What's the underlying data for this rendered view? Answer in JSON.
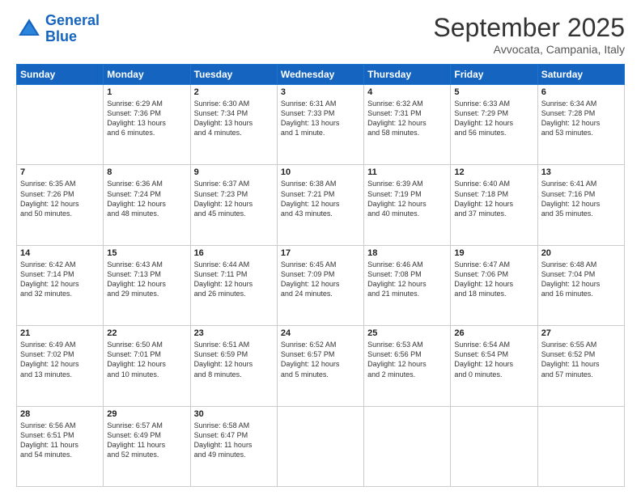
{
  "logo": {
    "line1": "General",
    "line2": "Blue"
  },
  "title": "September 2025",
  "location": "Avvocata, Campania, Italy",
  "weekdays": [
    "Sunday",
    "Monday",
    "Tuesday",
    "Wednesday",
    "Thursday",
    "Friday",
    "Saturday"
  ],
  "weeks": [
    [
      {
        "day": "",
        "info": ""
      },
      {
        "day": "1",
        "info": "Sunrise: 6:29 AM\nSunset: 7:36 PM\nDaylight: 13 hours\nand 6 minutes."
      },
      {
        "day": "2",
        "info": "Sunrise: 6:30 AM\nSunset: 7:34 PM\nDaylight: 13 hours\nand 4 minutes."
      },
      {
        "day": "3",
        "info": "Sunrise: 6:31 AM\nSunset: 7:33 PM\nDaylight: 13 hours\nand 1 minute."
      },
      {
        "day": "4",
        "info": "Sunrise: 6:32 AM\nSunset: 7:31 PM\nDaylight: 12 hours\nand 58 minutes."
      },
      {
        "day": "5",
        "info": "Sunrise: 6:33 AM\nSunset: 7:29 PM\nDaylight: 12 hours\nand 56 minutes."
      },
      {
        "day": "6",
        "info": "Sunrise: 6:34 AM\nSunset: 7:28 PM\nDaylight: 12 hours\nand 53 minutes."
      }
    ],
    [
      {
        "day": "7",
        "info": "Sunrise: 6:35 AM\nSunset: 7:26 PM\nDaylight: 12 hours\nand 50 minutes."
      },
      {
        "day": "8",
        "info": "Sunrise: 6:36 AM\nSunset: 7:24 PM\nDaylight: 12 hours\nand 48 minutes."
      },
      {
        "day": "9",
        "info": "Sunrise: 6:37 AM\nSunset: 7:23 PM\nDaylight: 12 hours\nand 45 minutes."
      },
      {
        "day": "10",
        "info": "Sunrise: 6:38 AM\nSunset: 7:21 PM\nDaylight: 12 hours\nand 43 minutes."
      },
      {
        "day": "11",
        "info": "Sunrise: 6:39 AM\nSunset: 7:19 PM\nDaylight: 12 hours\nand 40 minutes."
      },
      {
        "day": "12",
        "info": "Sunrise: 6:40 AM\nSunset: 7:18 PM\nDaylight: 12 hours\nand 37 minutes."
      },
      {
        "day": "13",
        "info": "Sunrise: 6:41 AM\nSunset: 7:16 PM\nDaylight: 12 hours\nand 35 minutes."
      }
    ],
    [
      {
        "day": "14",
        "info": "Sunrise: 6:42 AM\nSunset: 7:14 PM\nDaylight: 12 hours\nand 32 minutes."
      },
      {
        "day": "15",
        "info": "Sunrise: 6:43 AM\nSunset: 7:13 PM\nDaylight: 12 hours\nand 29 minutes."
      },
      {
        "day": "16",
        "info": "Sunrise: 6:44 AM\nSunset: 7:11 PM\nDaylight: 12 hours\nand 26 minutes."
      },
      {
        "day": "17",
        "info": "Sunrise: 6:45 AM\nSunset: 7:09 PM\nDaylight: 12 hours\nand 24 minutes."
      },
      {
        "day": "18",
        "info": "Sunrise: 6:46 AM\nSunset: 7:08 PM\nDaylight: 12 hours\nand 21 minutes."
      },
      {
        "day": "19",
        "info": "Sunrise: 6:47 AM\nSunset: 7:06 PM\nDaylight: 12 hours\nand 18 minutes."
      },
      {
        "day": "20",
        "info": "Sunrise: 6:48 AM\nSunset: 7:04 PM\nDaylight: 12 hours\nand 16 minutes."
      }
    ],
    [
      {
        "day": "21",
        "info": "Sunrise: 6:49 AM\nSunset: 7:02 PM\nDaylight: 12 hours\nand 13 minutes."
      },
      {
        "day": "22",
        "info": "Sunrise: 6:50 AM\nSunset: 7:01 PM\nDaylight: 12 hours\nand 10 minutes."
      },
      {
        "day": "23",
        "info": "Sunrise: 6:51 AM\nSunset: 6:59 PM\nDaylight: 12 hours\nand 8 minutes."
      },
      {
        "day": "24",
        "info": "Sunrise: 6:52 AM\nSunset: 6:57 PM\nDaylight: 12 hours\nand 5 minutes."
      },
      {
        "day": "25",
        "info": "Sunrise: 6:53 AM\nSunset: 6:56 PM\nDaylight: 12 hours\nand 2 minutes."
      },
      {
        "day": "26",
        "info": "Sunrise: 6:54 AM\nSunset: 6:54 PM\nDaylight: 12 hours\nand 0 minutes."
      },
      {
        "day": "27",
        "info": "Sunrise: 6:55 AM\nSunset: 6:52 PM\nDaylight: 11 hours\nand 57 minutes."
      }
    ],
    [
      {
        "day": "28",
        "info": "Sunrise: 6:56 AM\nSunset: 6:51 PM\nDaylight: 11 hours\nand 54 minutes."
      },
      {
        "day": "29",
        "info": "Sunrise: 6:57 AM\nSunset: 6:49 PM\nDaylight: 11 hours\nand 52 minutes."
      },
      {
        "day": "30",
        "info": "Sunrise: 6:58 AM\nSunset: 6:47 PM\nDaylight: 11 hours\nand 49 minutes."
      },
      {
        "day": "",
        "info": ""
      },
      {
        "day": "",
        "info": ""
      },
      {
        "day": "",
        "info": ""
      },
      {
        "day": "",
        "info": ""
      }
    ]
  ]
}
